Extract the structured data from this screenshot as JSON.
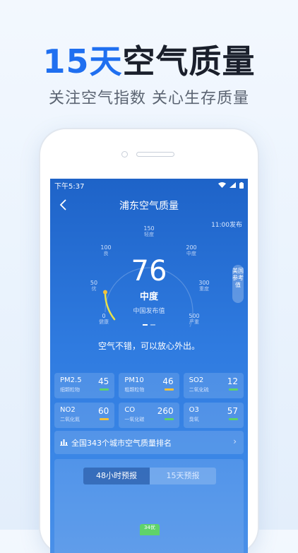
{
  "hero": {
    "title_num": "15天",
    "title_rest": "空气质量",
    "subtitle": "关注空气指数 关心生存质量"
  },
  "status_bar": {
    "time": "下午5:37"
  },
  "nav": {
    "title": "浦东空气质量",
    "publish_time": "11:00发布"
  },
  "gauge": {
    "ticks": [
      {
        "value": "0",
        "label": "健康"
      },
      {
        "value": "50",
        "label": "优"
      },
      {
        "value": "100",
        "label": "良"
      },
      {
        "value": "150",
        "label": "轻度"
      },
      {
        "value": "200",
        "label": "中度"
      },
      {
        "value": "300",
        "label": "重度"
      },
      {
        "value": "500",
        "label": "严重"
      }
    ],
    "aqi": "76",
    "level": "中度",
    "source": "中国发布值",
    "us_reference": "美国参考值",
    "progress_fraction": 0.15
  },
  "advice": "空气不错，可以放心外出。",
  "pollutants": [
    {
      "name": "PM2.5",
      "desc": "细颗粒物",
      "value": "45",
      "bar_color": "#5fd36a"
    },
    {
      "name": "PM10",
      "desc": "粗颗粒物",
      "value": "46",
      "bar_color": "#f2c23a"
    },
    {
      "name": "SO2",
      "desc": "二氧化硫",
      "value": "12",
      "bar_color": "#5fd36a"
    },
    {
      "name": "NO2",
      "desc": "二氧化氮",
      "value": "60",
      "bar_color": "#f2c23a"
    },
    {
      "name": "CO",
      "desc": "一氧化碳",
      "value": "260",
      "bar_color": "#5fd36a"
    },
    {
      "name": "O3",
      "desc": "臭氧",
      "value": "57",
      "bar_color": "#5fd36a"
    }
  ],
  "ranking": {
    "text": "全国343个城市空气质量排名"
  },
  "forecast": {
    "tabs": [
      "48小时预报",
      "15天预报"
    ],
    "active_tab": 0,
    "bar_label": "34优"
  },
  "colors": {
    "accent": "#1f6ff0",
    "gauge_arc": "#e8e14a",
    "good": "#5fd36a",
    "moderate": "#f2c23a"
  }
}
